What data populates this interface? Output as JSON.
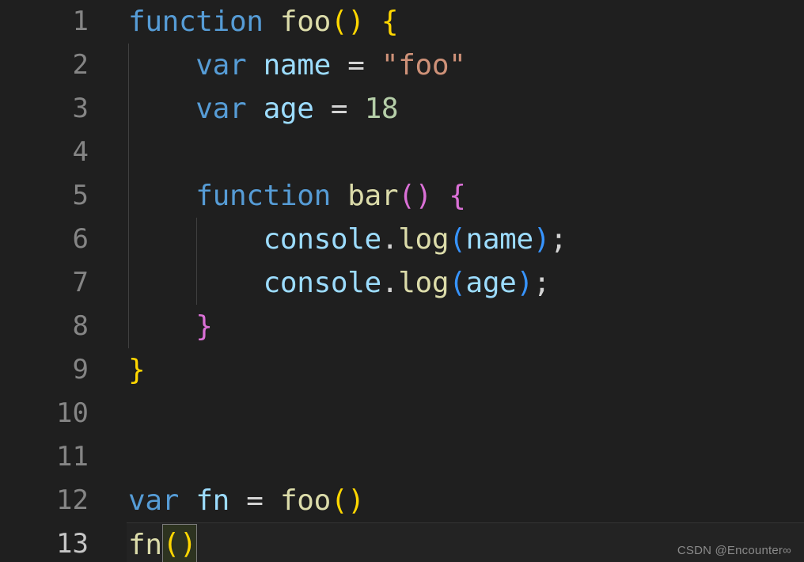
{
  "editor": {
    "background_color": "#1f1f1f",
    "language": "javascript",
    "active_line": 13,
    "gutter": {
      "line_numbers": [
        "1",
        "2",
        "3",
        "4",
        "5",
        "6",
        "7",
        "8",
        "9",
        "10",
        "11",
        "12",
        "13"
      ],
      "color": "#858585",
      "active_color": "#c6c6c6"
    },
    "lines": [
      {
        "number": "1",
        "tokens": [
          {
            "text": "function",
            "kind": "keyword"
          },
          {
            "text": " ",
            "kind": "plain"
          },
          {
            "text": "foo",
            "kind": "function"
          },
          {
            "text": "()",
            "kind": "bracket1"
          },
          {
            "text": " ",
            "kind": "plain"
          },
          {
            "text": "{",
            "kind": "bracket1"
          }
        ]
      },
      {
        "number": "2",
        "tokens": [
          {
            "text": "    ",
            "kind": "plain"
          },
          {
            "text": "var",
            "kind": "keyword"
          },
          {
            "text": " ",
            "kind": "plain"
          },
          {
            "text": "name",
            "kind": "variable"
          },
          {
            "text": " ",
            "kind": "plain"
          },
          {
            "text": "=",
            "kind": "plain"
          },
          {
            "text": " ",
            "kind": "plain"
          },
          {
            "text": "\"foo\"",
            "kind": "string"
          }
        ]
      },
      {
        "number": "3",
        "tokens": [
          {
            "text": "    ",
            "kind": "plain"
          },
          {
            "text": "var",
            "kind": "keyword"
          },
          {
            "text": " ",
            "kind": "plain"
          },
          {
            "text": "age",
            "kind": "variable"
          },
          {
            "text": " ",
            "kind": "plain"
          },
          {
            "text": "=",
            "kind": "plain"
          },
          {
            "text": " ",
            "kind": "plain"
          },
          {
            "text": "18",
            "kind": "number"
          }
        ]
      },
      {
        "number": "4",
        "tokens": []
      },
      {
        "number": "5",
        "tokens": [
          {
            "text": "    ",
            "kind": "plain"
          },
          {
            "text": "function",
            "kind": "keyword"
          },
          {
            "text": " ",
            "kind": "plain"
          },
          {
            "text": "bar",
            "kind": "function"
          },
          {
            "text": "()",
            "kind": "bracket2"
          },
          {
            "text": " ",
            "kind": "plain"
          },
          {
            "text": "{",
            "kind": "bracket2"
          }
        ]
      },
      {
        "number": "6",
        "tokens": [
          {
            "text": "        ",
            "kind": "plain"
          },
          {
            "text": "console",
            "kind": "variable"
          },
          {
            "text": ".",
            "kind": "plain"
          },
          {
            "text": "log",
            "kind": "function"
          },
          {
            "text": "(",
            "kind": "bracket3"
          },
          {
            "text": "name",
            "kind": "variable"
          },
          {
            "text": ")",
            "kind": "bracket3"
          },
          {
            "text": ";",
            "kind": "plain"
          }
        ]
      },
      {
        "number": "7",
        "tokens": [
          {
            "text": "        ",
            "kind": "plain"
          },
          {
            "text": "console",
            "kind": "variable"
          },
          {
            "text": ".",
            "kind": "plain"
          },
          {
            "text": "log",
            "kind": "function"
          },
          {
            "text": "(",
            "kind": "bracket3"
          },
          {
            "text": "age",
            "kind": "variable"
          },
          {
            "text": ")",
            "kind": "bracket3"
          },
          {
            "text": ";",
            "kind": "plain"
          }
        ]
      },
      {
        "number": "8",
        "tokens": [
          {
            "text": "    ",
            "kind": "plain"
          },
          {
            "text": "}",
            "kind": "bracket2"
          }
        ]
      },
      {
        "number": "9",
        "tokens": [
          {
            "text": "}",
            "kind": "bracket1"
          }
        ]
      },
      {
        "number": "10",
        "tokens": []
      },
      {
        "number": "11",
        "tokens": []
      },
      {
        "number": "12",
        "tokens": [
          {
            "text": "var",
            "kind": "keyword"
          },
          {
            "text": " ",
            "kind": "plain"
          },
          {
            "text": "fn",
            "kind": "variable"
          },
          {
            "text": " ",
            "kind": "plain"
          },
          {
            "text": "=",
            "kind": "plain"
          },
          {
            "text": " ",
            "kind": "plain"
          },
          {
            "text": "foo",
            "kind": "function"
          },
          {
            "text": "()",
            "kind": "bracket1"
          }
        ]
      },
      {
        "number": "13",
        "tokens": [
          {
            "text": "fn",
            "kind": "function"
          },
          {
            "text": "()",
            "kind": "bracket1",
            "selected": true
          }
        ]
      }
    ],
    "indent_guides": [
      {
        "level": 1,
        "from_line": 2,
        "to_line": 8
      },
      {
        "level": 2,
        "from_line": 6,
        "to_line": 7
      }
    ],
    "colors": {
      "keyword": "#569cd6",
      "function": "#dcdcaa",
      "variable": "#9cdcfe",
      "string": "#ce9178",
      "number": "#b5cea8",
      "plain": "#d4d4d4",
      "bracket1": "#ffd700",
      "bracket2": "#da70d6",
      "bracket3": "#3794ff",
      "selection_background": "#2d3320",
      "selection_border": "#7a7a7a",
      "active_line_background": "#232323",
      "indent_guide": "#404040"
    }
  },
  "watermark": {
    "text": "CSDN @Encounter∞"
  }
}
